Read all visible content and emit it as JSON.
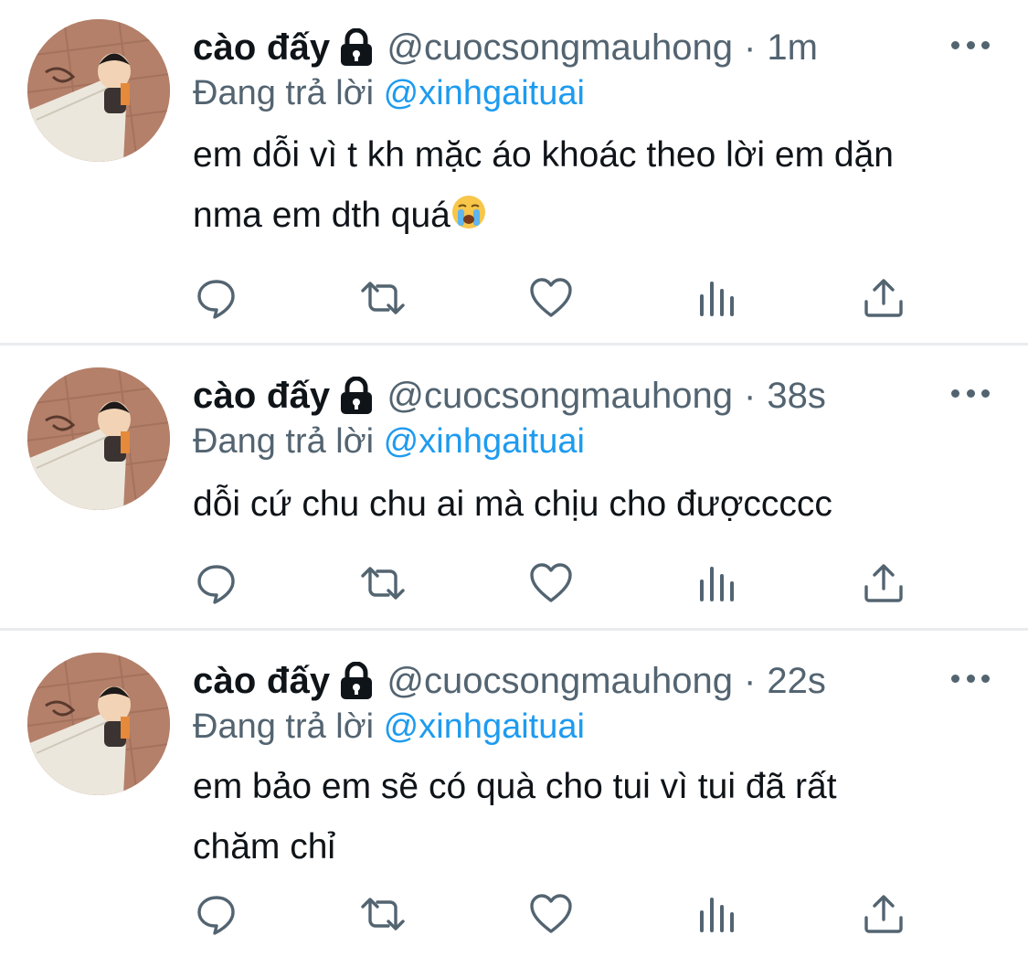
{
  "colors": {
    "name": "#0f1419",
    "secondary": "#536471",
    "link": "#1d9bf0",
    "divider": "#e9ecef"
  },
  "tweets": [
    {
      "display_name": "cào đấy",
      "handle": "@cuocsongmauhong",
      "dot": "·",
      "time": "1m",
      "reply_prefix": "Đang trả lời",
      "reply_to": "@xinhgaituai",
      "text_line1": "em dỗi vì t kh mặc áo khoác theo lời em dặn",
      "text_line2": "nma em dth quá",
      "emoji": "loudly-crying-face-icon"
    },
    {
      "display_name": "cào đấy",
      "handle": "@cuocsongmauhong",
      "dot": "·",
      "time": "38s",
      "reply_prefix": "Đang trả lời",
      "reply_to": "@xinhgaituai",
      "text_line1": "dỗi cứ chu chu ai mà chịu cho đượccccc"
    },
    {
      "display_name": "cào đấy",
      "handle": "@cuocsongmauhong",
      "dot": "·",
      "time": "22s",
      "reply_prefix": "Đang trả lời",
      "reply_to": "@xinhgaituai",
      "text_line1": "em bảo em sẽ có quà cho tui vì tui đã rất",
      "text_line2": "chăm chỉ"
    }
  ],
  "icons": {
    "lock": "lock-icon",
    "more": "more-icon",
    "reply": "reply-icon",
    "retweet": "retweet-icon",
    "like": "heart-icon",
    "analytics": "analytics-icon",
    "share": "share-icon"
  }
}
